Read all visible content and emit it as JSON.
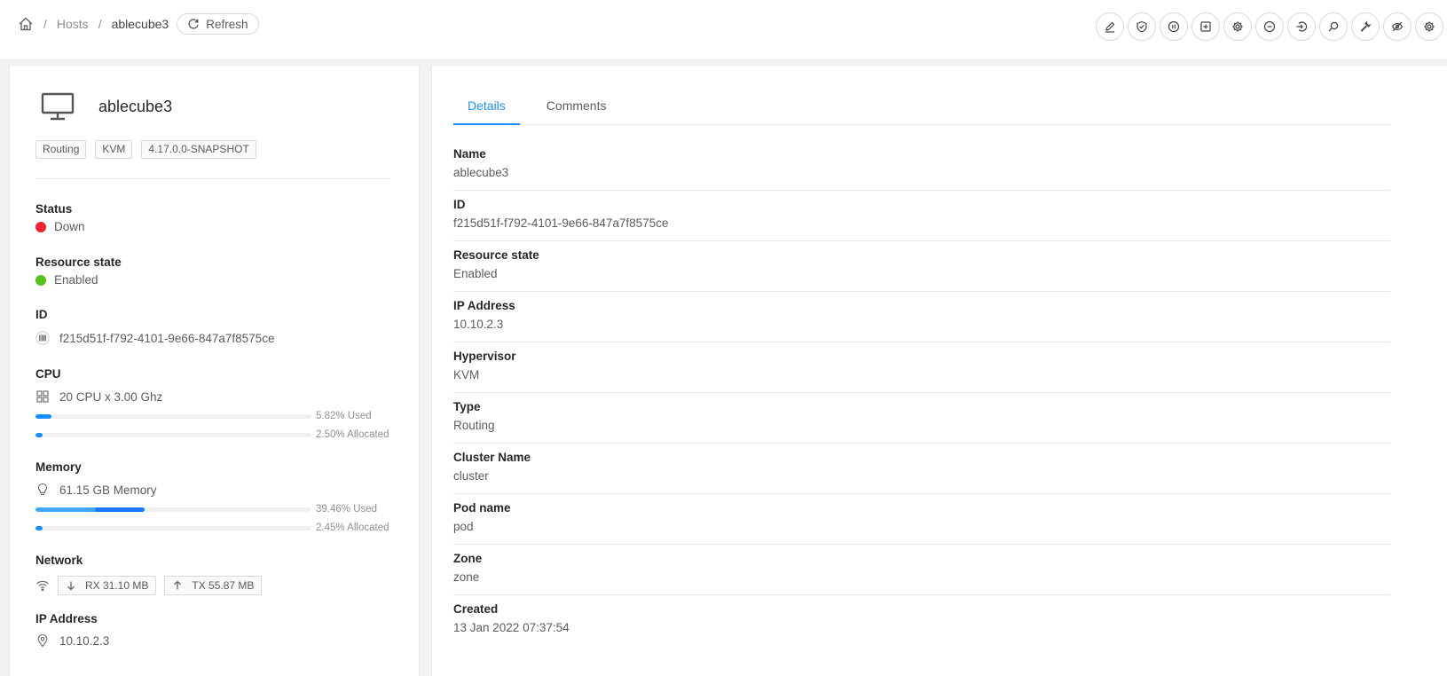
{
  "breadcrumb": {
    "hosts": "Hosts",
    "current": "ablecube3"
  },
  "refresh_label": "Refresh",
  "actions": [
    "edit-icon",
    "shield-icon",
    "pause-icon",
    "plus-square-icon",
    "gear-icon",
    "minus-circle-icon",
    "login-icon",
    "search-icon",
    "wrench-icon",
    "eye-invisible-icon",
    "gear-icon"
  ],
  "host": {
    "name": "ablecube3",
    "tags": [
      "Routing",
      "KVM",
      "4.17.0.0-SNAPSHOT"
    ],
    "status_label": "Status",
    "status": "Down",
    "status_color": "#f5222d",
    "resource_state_label": "Resource state",
    "resource_state": "Enabled",
    "resource_state_color": "#52c41a",
    "id_label": "ID",
    "id": "f215d51f-f792-4101-9e66-847a7f8575ce",
    "cpu_label": "CPU",
    "cpu": "20 CPU x 3.00 Ghz",
    "cpu_used": "5.82% Used",
    "cpu_used_value": 5.82,
    "cpu_allocated": "2.50% Allocated",
    "cpu_allocated_value": 2.5,
    "memory_label": "Memory",
    "memory": "61.15 GB Memory",
    "memory_used": "39.46% Used",
    "memory_used_value": 39.46,
    "memory_allocated": "2.45% Allocated",
    "memory_allocated_value": 2.45,
    "network_label": "Network",
    "rx": "RX 31.10 MB",
    "tx": "TX 55.87 MB",
    "ip_label": "IP Address",
    "ip": "10.10.2.3"
  },
  "tabs": [
    {
      "label": "Details",
      "active": true
    },
    {
      "label": "Comments",
      "active": false
    }
  ],
  "details": [
    {
      "key": "Name",
      "value": "ablecube3"
    },
    {
      "key": "ID",
      "value": "f215d51f-f792-4101-9e66-847a7f8575ce"
    },
    {
      "key": "Resource state",
      "value": "Enabled"
    },
    {
      "key": "IP Address",
      "value": "10.10.2.3"
    },
    {
      "key": "Hypervisor",
      "value": "KVM"
    },
    {
      "key": "Type",
      "value": "Routing"
    },
    {
      "key": "Cluster Name",
      "value": "cluster"
    },
    {
      "key": "Pod name",
      "value": "pod"
    },
    {
      "key": "Zone",
      "value": "zone"
    },
    {
      "key": "Created",
      "value": "13 Jan 2022 07:37:54"
    }
  ]
}
